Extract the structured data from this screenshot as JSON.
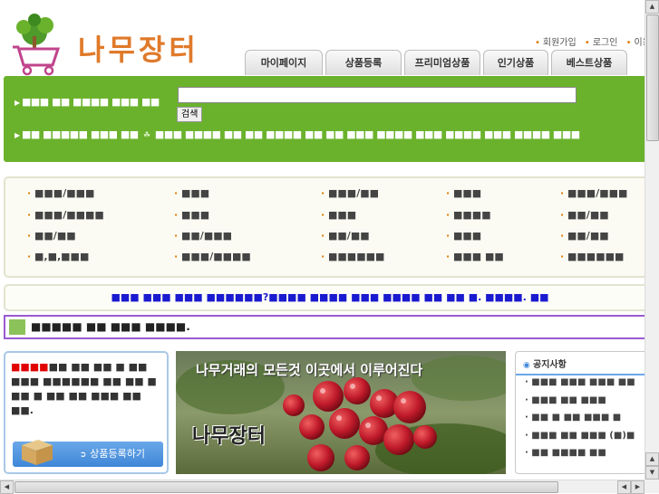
{
  "header": {
    "logo_text": "나무장터",
    "top_links": [
      "회원가입",
      "로그인",
      "이용안내"
    ],
    "tabs": [
      "마이페이지",
      "상품등록",
      "프리미엄상품",
      "인기상품",
      "베스트상품"
    ]
  },
  "search": {
    "label": "■■■ ■■ ■■■■ ■■■ ■■",
    "input_value": "",
    "button_label": "검색",
    "popular_label": "■■ ■■■■■ ■■■ ■■",
    "popular_terms": "■■■ ■■■■ ■■ ■■ ■■■■ ■■ ■■ ■■■ ■■■■ ■■■ ■■■■ ■■■ ■■■■ ■■■"
  },
  "categories": [
    [
      "■■■/■■■",
      "■■■",
      "■■■/■■",
      "■■■",
      "■■■/■■■"
    ],
    [
      "■■■/■■■■",
      "■■■",
      "■■■",
      "■■■■",
      "■■/■■"
    ],
    [
      "■■/■■",
      "■■/■■■",
      "■■/■■",
      "■■■",
      "■■/■■"
    ],
    [
      "■,■,■■■",
      "■■■/■■■■",
      "■■■■■■",
      "■■■ ■■",
      "■■■■■■"
    ]
  ],
  "notice_strip": "■■■ ■■■ ■■■ ■■■■■■?■■■■ ■■■■ ■■■ ■■■■ ■■ ■■ ■. ■■■■. ■■",
  "purple_strip": "■■■■■ ■■ ■■■ ■■■■.",
  "promo": {
    "highlight": "■■■■",
    "text": "■■ ■■ ■■ ■ ■■ ■■■ ■■■■■■ ■■ ■■ ■ ■■ ■ ■■ ■■ ■■■ ■■ ■■.",
    "button_label": "상품등록하기"
  },
  "banner": {
    "title": "나무거래의 모든것 이곳에서 이루어진다",
    "brand": "나무장터"
  },
  "board": {
    "title": "공지사항",
    "items": [
      "■■■ ■■■ ■■■ ■■",
      "■■■ ■■ ■■■",
      "■■ ■ ■■ ■■■ ■",
      "■■■ ■■ ■■■ (■)■",
      "■■ ■■■■ ■■"
    ]
  },
  "colors": {
    "green_bar": "#6ab22c",
    "notice_blue": "#1a1ad0",
    "purple_border": "#9a5ad0",
    "promo_highlight": "#e00000"
  }
}
